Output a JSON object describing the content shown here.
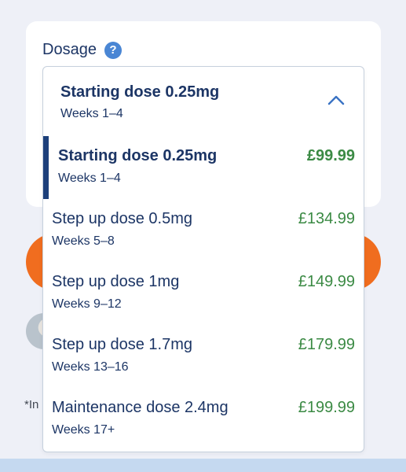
{
  "dosage": {
    "label": "Dosage",
    "help_icon": "question-icon",
    "help_symbol": "?"
  },
  "selected": {
    "title": "Starting dose 0.25mg",
    "weeks": "Weeks 1–4",
    "chevron_icon": "chevron-up-icon"
  },
  "options": [
    {
      "label": "Starting dose 0.25mg",
      "weeks": "Weeks 1–4",
      "price": "£99.99",
      "selected": true
    },
    {
      "label": "Step up dose 0.5mg",
      "weeks": "Weeks 5–8",
      "price": "£134.99",
      "selected": false
    },
    {
      "label": "Step up dose 1mg",
      "weeks": "Weeks 9–12",
      "price": "£149.99",
      "selected": false
    },
    {
      "label": "Step up dose 1.7mg",
      "weeks": "Weeks 13–16",
      "price": "£179.99",
      "selected": false
    },
    {
      "label": "Maintenance dose 2.4mg",
      "weeks": "Weeks 17+",
      "price": "£199.99",
      "selected": false
    }
  ],
  "footnote_prefix": "*In",
  "colors": {
    "navy": "#1c3565",
    "price_green": "#3b8a44",
    "accent_orange": "#f06d1f",
    "help_blue": "#4a86d4",
    "selection_bar": "#1c3f7a"
  }
}
